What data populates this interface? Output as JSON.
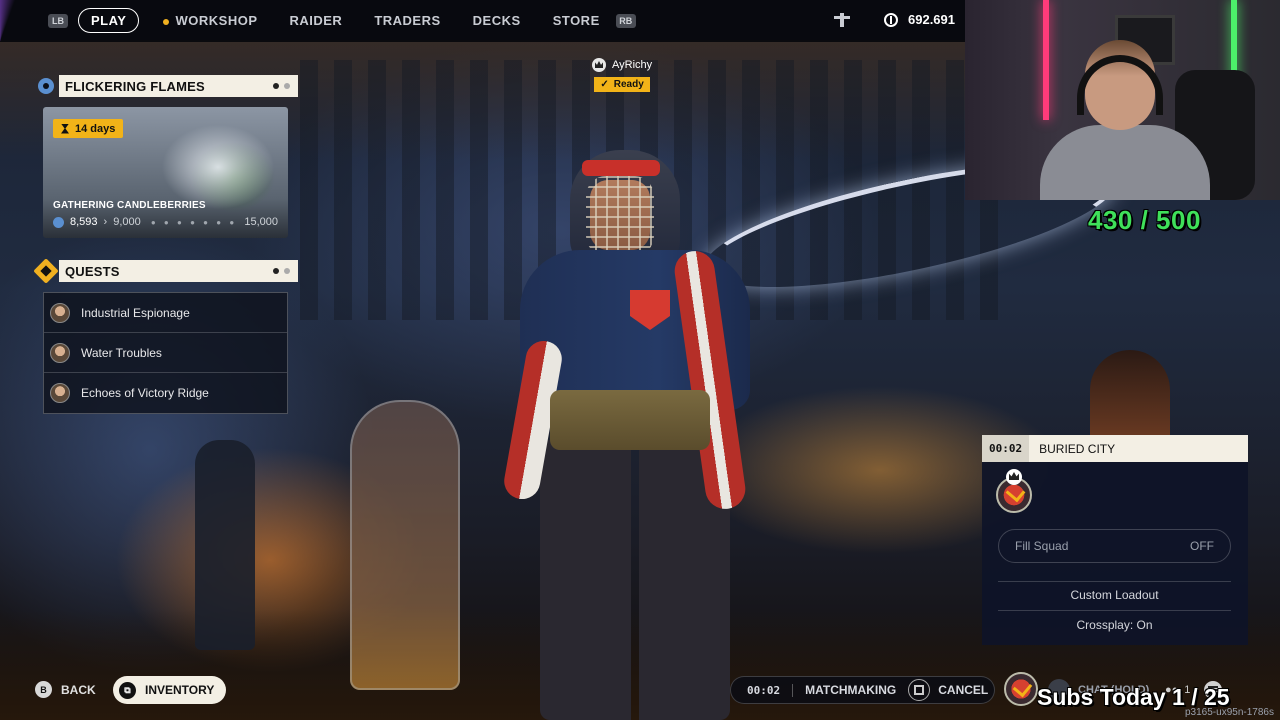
{
  "nav": {
    "lb": "LB",
    "rb": "RB",
    "items": [
      "PLAY",
      "WORKSHOP",
      "RAIDER",
      "TRADERS",
      "DECKS",
      "STORE"
    ],
    "currency_value": "692.691"
  },
  "event": {
    "title": "FLICKERING FLAMES",
    "timer": "14  days",
    "subtitle": "GATHERING CANDLEBERRIES",
    "progress_current": "8,593",
    "progress_next": "9,000",
    "progress_max": "15,000"
  },
  "quests": {
    "title": "QUESTS",
    "items": [
      "Industrial Espionage",
      "Water Troubles",
      "Echoes of Victory Ridge"
    ]
  },
  "player": {
    "name": "AyRichy",
    "status": "Ready"
  },
  "stream": {
    "sub_goal": "430 / 500",
    "subs_today": "Subs Today  1 / 25"
  },
  "squad": {
    "time": "00:02",
    "map": "BURIED CITY",
    "fill_squad_label": "Fill Squad",
    "fill_squad_value": "OFF",
    "custom_loadout": "Custom Loadout",
    "crossplay": "Crossplay: On"
  },
  "bottom": {
    "back_key": "B",
    "back_label": "BACK",
    "inventory_label": "INVENTORY",
    "mm_time": "00:02",
    "mm_label": "MATCHMAKING",
    "cancel_label": "CANCEL",
    "chat_label": "CHAT (HOLD)",
    "party_count": "1",
    "build_id": "p3165-ux95n-1786s"
  },
  "colors": {
    "accent_yellow": "#f2b318",
    "panel_cream": "#f3efe4",
    "sub_green": "#3fe05a"
  }
}
